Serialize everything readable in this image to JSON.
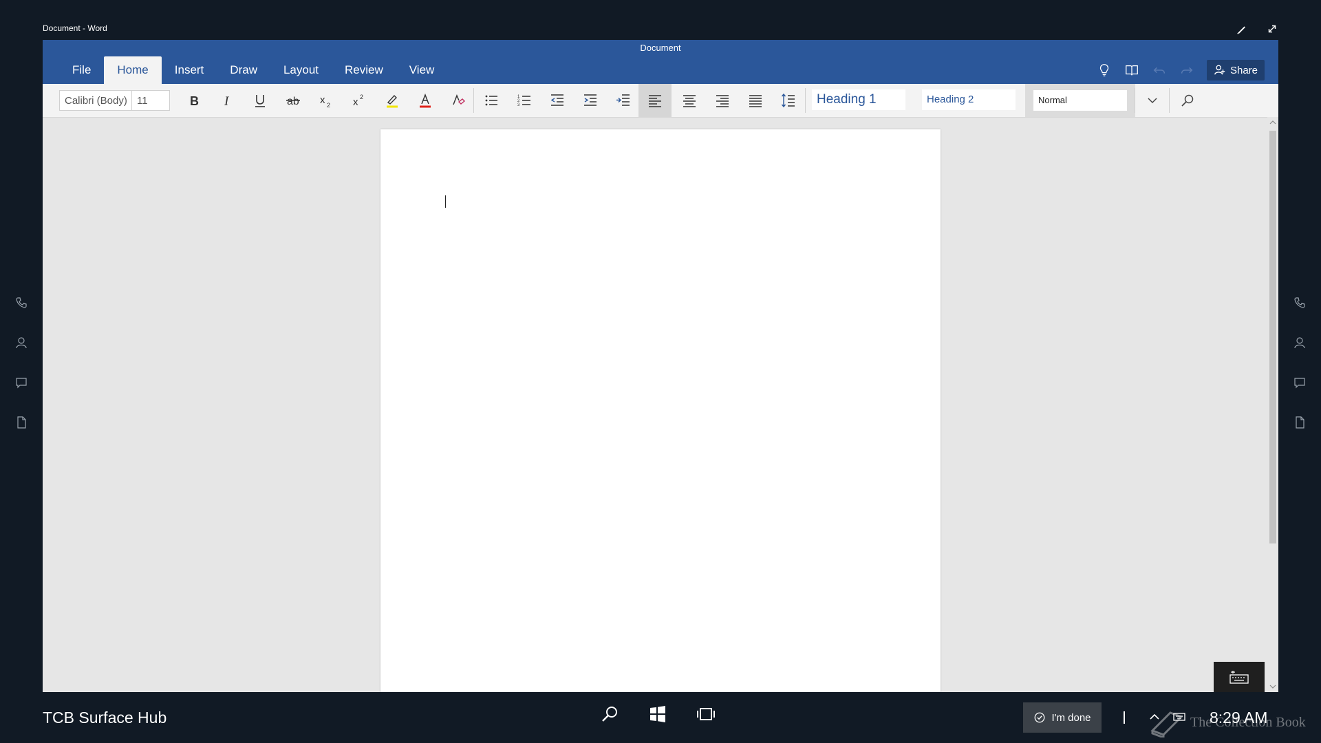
{
  "window": {
    "title": "Document - Word"
  },
  "app": {
    "doc_name": "Document",
    "tabs": [
      {
        "label": "File"
      },
      {
        "label": "Home",
        "active": true
      },
      {
        "label": "Insert"
      },
      {
        "label": "Draw"
      },
      {
        "label": "Layout"
      },
      {
        "label": "Review"
      },
      {
        "label": "View"
      }
    ],
    "share_label": "Share",
    "font_name": "Calibri (Body)",
    "font_size": "11",
    "styles": {
      "heading1": "Heading 1",
      "heading2": "Heading 2",
      "normal": "Normal"
    },
    "colors": {
      "ribbon": "#2b579a",
      "highlight": "#f2e600",
      "font_color": "#e0241b"
    }
  },
  "taskbar": {
    "device_name": "TCB Surface Hub",
    "done_label": "I'm done",
    "time": "8:29 AM"
  },
  "watermark": "The Collection Book"
}
